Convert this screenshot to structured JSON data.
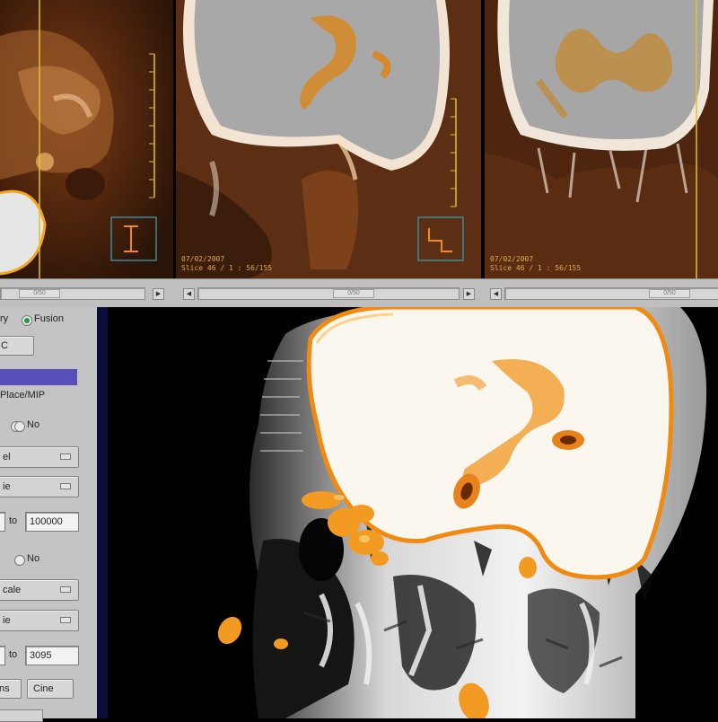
{
  "viewers": [
    {
      "name": "sagittal",
      "date": "",
      "slice": "",
      "icon": "slice-orientation-icon"
    },
    {
      "name": "coronal",
      "date": "07/02/2007",
      "slice": "Slice 46 / 1 : 56/155",
      "icon": "slice-orientation-icon"
    },
    {
      "name": "axial",
      "date": "07/02/2007",
      "slice": "Slice 46 / 1 : 56/155",
      "icon": ""
    }
  ],
  "scrollbars": [
    {
      "value": "0/50"
    },
    {
      "value": "0/50"
    },
    {
      "value": "0/50"
    }
  ],
  "panel": {
    "mode_radio_left": "ry",
    "mode_radio_right": "Fusion",
    "top_button": "C",
    "list_selected": "",
    "list_item_2": "Place/MIP",
    "radio_row1_option": "No",
    "combo1_value": "el",
    "combo2_value": "ie",
    "range1_to_label": "to",
    "range1_to_value": "100000",
    "radio_row2_option": "No",
    "combo3_value": "cale",
    "combo4_value": "ie",
    "range2_to_label": "to",
    "range2_to_value": "3095",
    "btn_bottom_left": "ns",
    "btn_bottom_right": "Cine"
  },
  "colors": {
    "panel_bg": "#c4c4c4",
    "selection": "#5850b8",
    "radio_active": "#1f9c3d",
    "overlay_text": "#f5c35a",
    "fusion_orange": "#f08a10"
  }
}
